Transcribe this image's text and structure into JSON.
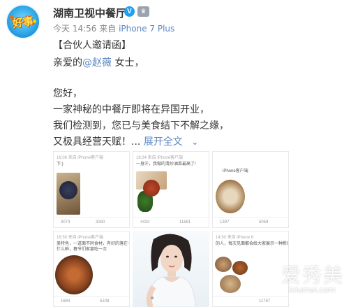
{
  "post": {
    "avatar_text": "好事",
    "username": "湖南卫视中餐厅",
    "verified_icon": "V",
    "crown_icon": "♛",
    "time": "今天 14:56",
    "source_prefix": "来自",
    "source": "iPhone 7 Plus",
    "lines": {
      "l1": "【合伙人邀请函】",
      "l2_prefix": "亲爱的",
      "l2_mention": "@赵薇",
      "l2_suffix": " 女士，",
      "l3": "您好，",
      "l4": "一家神秘的中餐厅即将在异国开业，",
      "l5": "我们检测到，您已与美食结下不解之缘，",
      "l6": "又极具经营天赋！...",
      "expand": "展开全文",
      "expand_icon": "⌄"
    }
  },
  "thumbs": [
    {
      "hdr": "16:06 来自 iPhone客户端",
      "cap": "下:)",
      "left": "3074",
      "right": "3280"
    },
    {
      "hdr": "18:34 来自 iPhone客户端",
      "cap": "一身汗，我做的清炒油菜最高了!",
      "left": "4433",
      "right": "11681"
    },
    {
      "hdr": "",
      "cap": "iPhone客户端",
      "left": "1397",
      "right": "5059"
    },
    {
      "hdr": "16:50 来自 iPhone客户端",
      "cap": "美特色，一道面不同食材，有好的落在一个大盆里，",
      "cap2": "什么鲜，春节们家宴吃一次",
      "left": "1684",
      "right": "5108"
    },
    {
      "hdr": "14:50 来自 iPhone 6",
      "cap": "的人，每次见面都会给大家展示一种新奇的美食，",
      "cap2": "",
      "left": "",
      "right": "11767"
    }
  ],
  "watermark": {
    "main": "爱秀美",
    "sub": "ixiumei.com"
  },
  "colors": {
    "link": "#5b86c4",
    "verified": "#1da0f2",
    "text": "#333333",
    "meta": "#888888"
  }
}
